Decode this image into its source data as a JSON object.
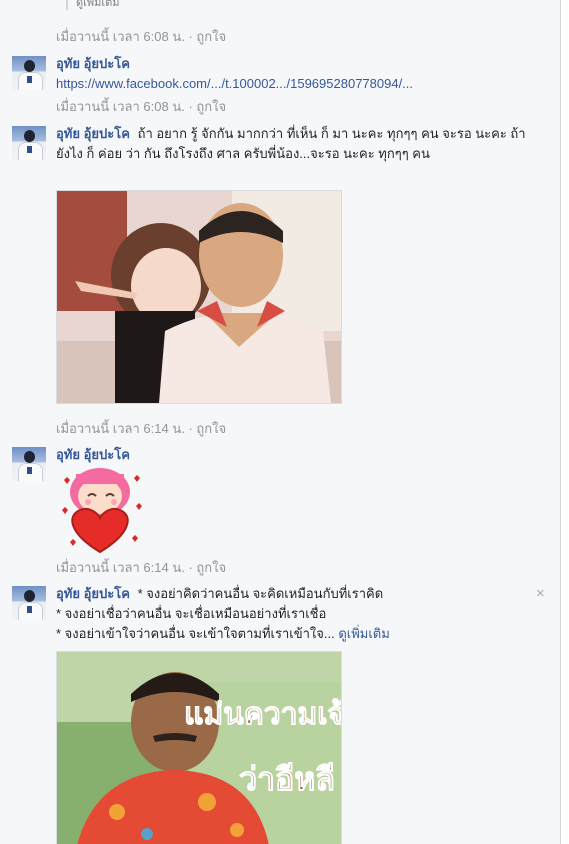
{
  "conversation": {
    "top_stub": "ดูเพิ่มเติม",
    "entries": [
      {
        "meta": "เมื่อวานนี้ เวลา 6:08 น.",
        "sep": " · ",
        "like": "ถูกใจ"
      },
      {
        "name": "อุทัย อุ้ยปะโค",
        "link": "https://www.facebook.com/.../t.100002.../159695280778094/...",
        "meta": "เมื่อวานนี้ เวลา 6:08 น.",
        "sep": " · ",
        "like": "ถูกใจ"
      },
      {
        "name": "อุทัย อุ้ยปะโค",
        "text": "ถ้า อยาก รู้ จักกัน มากกว่า ที่เห็น ก็ มา นะคะ ทุกๆๆ คน จะรอ นะคะ ถ้า ยังไง ก็ ค่อย ว่า กัน ถึงโรงถึง ศาล ครับพี่น้อง...จะรอ นะคะ ทุกๆๆ คน",
        "meta": "เมื่อวานนี้ เวลา 6:14 น.",
        "sep": " · ",
        "like": "ถูกใจ"
      },
      {
        "name": "อุทัย อุ้ยปะโค",
        "meta": "เมื่อวานนี้ เวลา 6:14 น.",
        "sep": " · ",
        "like": "ถูกใจ"
      },
      {
        "name": "อุทัย อุ้ยปะโค",
        "line1": "* จงอย่าคิดว่าคนอื่น จะคิดเหมือนกับที่เราคิด",
        "line2": "* จงอย่าเชื่อว่าคนอื่น จะเชื่อเหมือนอย่างที่เราเชื่อ",
        "line3": "* จงอย่าเข้าใจว่าคนอื่น จะเข้าใจตามที่เราเข้าใจ...",
        "see_more": "ดูเพิ่มเติม",
        "photo_caption_1": "แม่นความเจ้า",
        "photo_caption_2": "ว่าอีหลี"
      }
    ],
    "close_symbol": "×"
  },
  "colors": {
    "link": "#365899",
    "meta": "#90949c",
    "background": "#f6f7f9"
  },
  "icons": [
    "avatar",
    "heart-sticker",
    "close-icon"
  ]
}
